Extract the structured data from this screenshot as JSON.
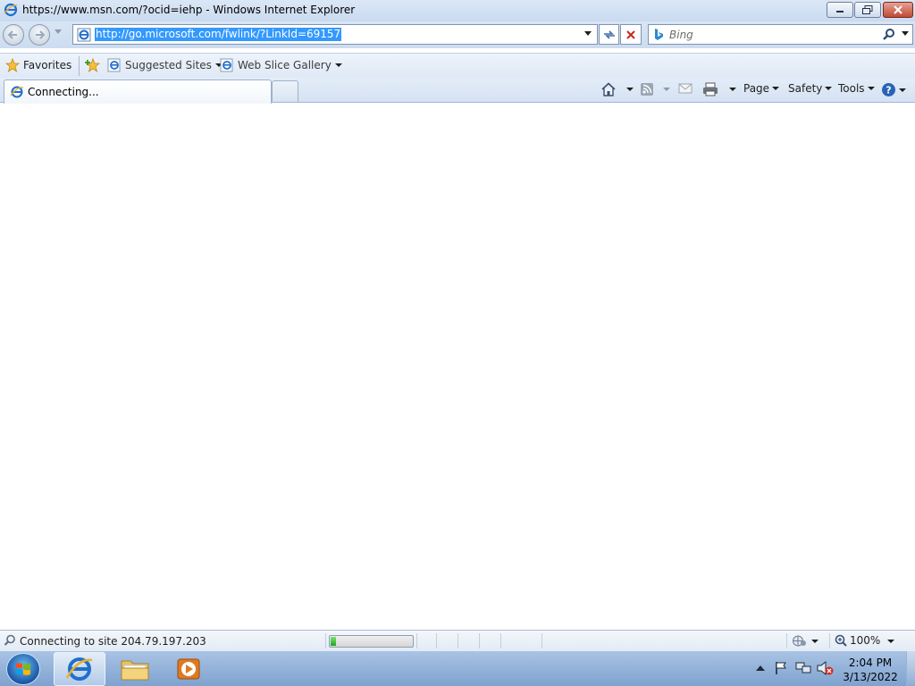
{
  "window": {
    "title": "https://www.msn.com/?ocid=iehp - Windows Internet Explorer"
  },
  "navigation": {
    "address_url": "http://go.microsoft.com/fwlink/?LinkId=69157",
    "search_placeholder": "Bing"
  },
  "favorites_bar": {
    "favorites_label": "Favorites",
    "items": [
      {
        "label": "Suggested Sites"
      },
      {
        "label": "Web Slice Gallery"
      }
    ]
  },
  "tabs": [
    {
      "label": "Connecting...",
      "active": true
    }
  ],
  "command_bar": {
    "page_label": "Page",
    "safety_label": "Safety",
    "tools_label": "Tools"
  },
  "status_bar": {
    "status_text": "Connecting to site 204.79.197.203",
    "progress_fraction": 0.07,
    "zoom_label": "100%"
  },
  "taskbar": {
    "clock_time": "2:04 PM",
    "clock_date": "3/13/2022"
  },
  "icons": {
    "app": "internet-explorer-icon",
    "back": "back-arrow-icon",
    "forward": "forward-arrow-icon",
    "refresh": "refresh-icon",
    "stop": "stop-icon",
    "search": "magnifier-icon",
    "favorites": "star-icon",
    "home": "home-icon",
    "feeds": "rss-feed-icon",
    "mail": "mail-icon",
    "print": "printer-icon",
    "help": "help-icon"
  },
  "colors": {
    "selection": "#3399ff",
    "progress_fill": "#1ea61e",
    "chrome_top": "#dbe7f6"
  }
}
